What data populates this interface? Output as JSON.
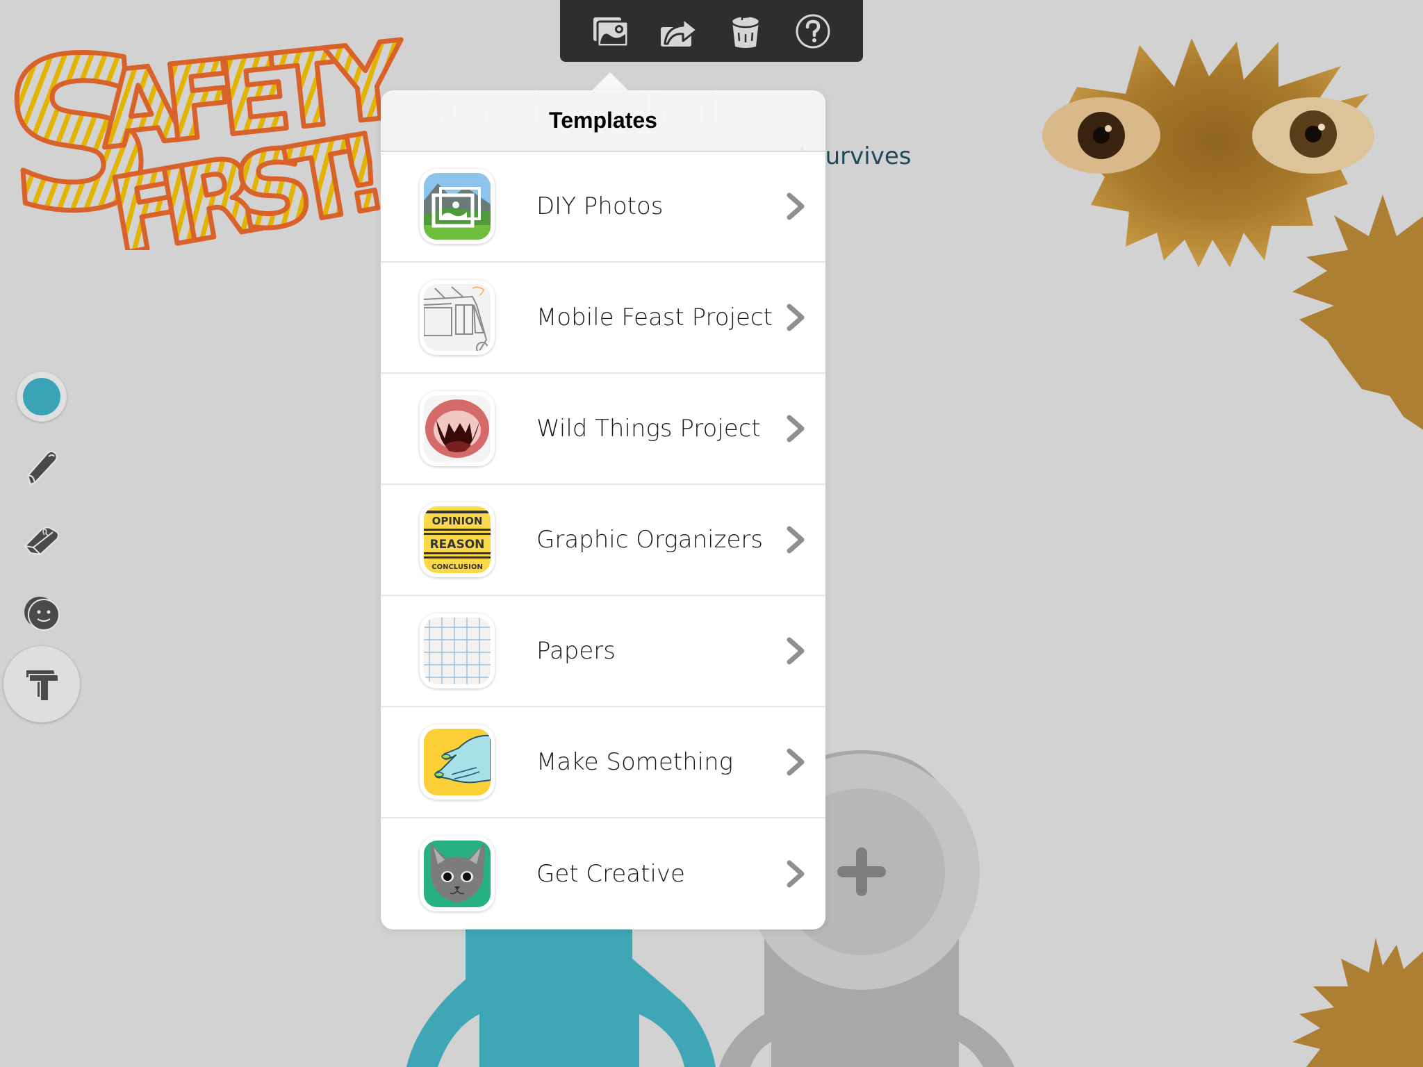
{
  "canvas": {
    "sticker_text": "SAFETY FIRST!",
    "title": "Survival Traits",
    "subtitle": "Describe what helps your animal survives",
    "subtitle_visible": "al survives",
    "colors": {
      "background": "#d2d2d2",
      "sticker_outline": "#d9622b",
      "sticker_stripes": "#e2b400",
      "monster": "#a97a2c",
      "teal_figure": "#3ea6b5",
      "grey_figure": "#a8a8a8"
    }
  },
  "toolbar": {
    "buttons": [
      {
        "name": "photos",
        "icon": "photos-icon",
        "label": "Photos"
      },
      {
        "name": "share",
        "icon": "share-icon",
        "label": "Share"
      },
      {
        "name": "trash",
        "icon": "trash-icon",
        "label": "Trash"
      },
      {
        "name": "help",
        "icon": "help-icon",
        "label": "Help"
      }
    ]
  },
  "tools": {
    "color": "#3aa4b6",
    "items": [
      {
        "name": "color-picker",
        "icon": "color-dot-icon"
      },
      {
        "name": "pen",
        "icon": "pen-icon"
      },
      {
        "name": "eraser",
        "icon": "eraser-icon"
      },
      {
        "name": "stickers",
        "icon": "sticker-face-icon"
      },
      {
        "name": "text",
        "icon": "text-tool-icon",
        "selected": true
      }
    ]
  },
  "popover": {
    "title": "Templates",
    "items": [
      {
        "label": "DIY Photos",
        "icon": "diy-photos-thumbnail"
      },
      {
        "label": "Mobile Feast Project",
        "icon": "food-truck-thumbnail"
      },
      {
        "label": "Wild Things Project",
        "icon": "fanged-mouth-thumbnail"
      },
      {
        "label": "Graphic Organizers",
        "icon": "opinion-reason-conclusion-thumbnail",
        "thumb_text": [
          "OPINION",
          "REASON",
          "CONCLUSION"
        ]
      },
      {
        "label": "Papers",
        "icon": "grid-paper-thumbnail"
      },
      {
        "label": "Make Something",
        "icon": "hands-thumbnail"
      },
      {
        "label": "Get Creative",
        "icon": "cat-face-thumbnail"
      }
    ]
  },
  "add_character": {
    "icon": "plus-icon"
  }
}
